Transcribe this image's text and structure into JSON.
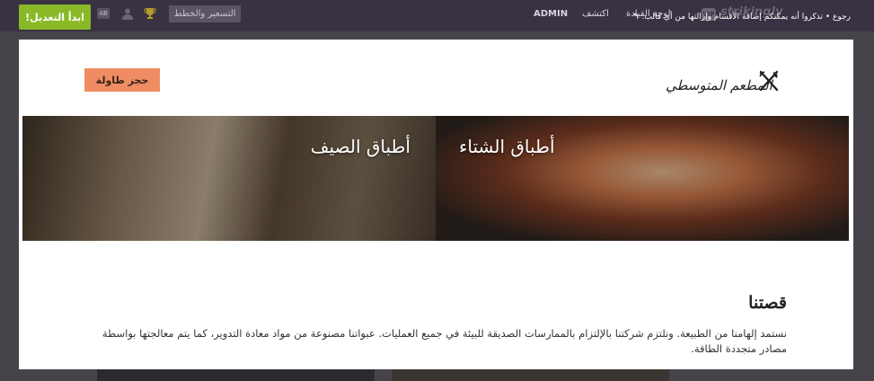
{
  "topbar": {
    "start_editing": "ابدأ التعديل!",
    "ab_badge": "AB",
    "pricing": "التسعير والخطط",
    "nav_admin": "ADMIN",
    "nav_discover": "اكتشف",
    "nav_dashboard": "لوحة القيادة",
    "logo_text": "strikingly",
    "back_link": "رجوع • تذكروا أنه يمكنكم إضافة الأقسام وإزالتها من أي قالب.",
    "icons": [
      "user-icon",
      "trophy-icon",
      "back-arrow-icon"
    ]
  },
  "site": {
    "book_table": "حجز طاولة",
    "brand_name": "المطعم المتوسطي",
    "banner": {
      "summer": "أطباق الصيف",
      "winter": "أطباق الشتاء"
    },
    "about": {
      "title": "قصتنا",
      "body": "نستمد إلهامنا من الطبيعة. ونلتزم شركتنا بالإلتزام بالممارسات الصديقة للبيئة في جميع العمليات. عبواتنا مصنوعة من مواد معادة التدوير، كما يتم معالجتها بواسطة مصادر متجددة الطاقة."
    }
  },
  "colors": {
    "topbar": "#3a3142",
    "start_button": "#8ab928",
    "book_button": "#ef8c64"
  }
}
